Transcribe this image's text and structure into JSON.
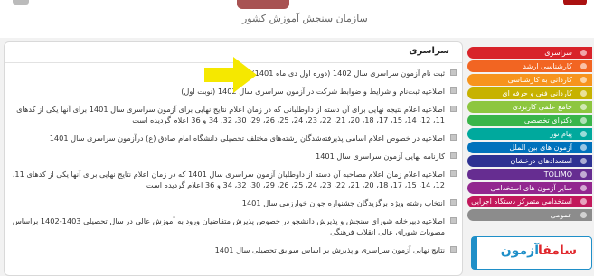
{
  "header": {
    "org_name": "سازمان سنجش آموزش کشور"
  },
  "news_panel": {
    "title": "سراسری",
    "items": [
      "ثبت نام آزمون سراسری سال 1402 (دوره اول دی ماه 1401)",
      "اطلاعیه ثبت‌نام و شرایط و ضوابط شرکت در آزمون سراسری سال 1402 (نوبت اول)",
      "اطلاعیه اعلام نتیجه نهایی برای آن دسته از داوطلبانی که در زمان اعلام نتایج نهایی برای آزمون سراسری سال 1401 برای آنها یکی از کدهای 11، 12، 14، 15، 17، 18، 20، 21، 22، 23، 24، 25، 26، 29، 30، 32، 34 و 36 اعلام گردیده است",
      "اطلاعیه در خصوص اعلام اسامی پذیرفته‌شدگان رشته‌های مختلف تحصیلی دانشگاه امام صادق (ع) درآزمون سراسری سال 1401",
      "کارنامه نهایی آزمون سراسری سال 1401",
      "اطلاعیه اعلام زمان اعلام مصاحبه آن دسته از داوطلبان آزمون سراسری سال 1401 که در زمان اعلام نتایج نهایی برای آنها یکی از کدهای 11، 12، 14، 15، 17، 18، 20، 21، 22، 23، 24، 25، 26، 29، 30، 32، 34 و 36 اعلام گردیده است",
      "انتخاب رشته ویژه برگزیدگان جشنواره جوان خوارزمی سال 1401",
      "اطلاعیه دبیرخانه شورای سنجش و پذیرش دانشجو در خصوص پذیرش متقاضیان ورود به آموزش عالی در سال تحصیلی 1403-1402 براساس مصوبات شورای عالی انقلاب فرهنگی",
      "نتایج نهایی آزمون سراسری و پذیرش بر اساس سوابق تحصیلی سال 1401"
    ]
  },
  "sidebar": {
    "items": [
      {
        "label": "سراسری",
        "color": "#d8232a"
      },
      {
        "label": "کارشناسی ارشد",
        "color": "#f26522"
      },
      {
        "label": "کاردانی به کارشناسی",
        "color": "#f7941d"
      },
      {
        "label": "کاردانی فنی و حرفه ای",
        "color": "#c7b200"
      },
      {
        "label": "جامع علمی کاربردی",
        "color": "#8dc63f"
      },
      {
        "label": "دکترای تخصصی",
        "color": "#39b54a"
      },
      {
        "label": "پیام نور",
        "color": "#00a99d"
      },
      {
        "label": "آزمون های بین الملل",
        "color": "#0072bc"
      },
      {
        "label": "استعدادهای درخشان",
        "color": "#2e3192"
      },
      {
        "label": "TOLIMO",
        "color": "#662d91"
      },
      {
        "label": "سایر آزمون های استخدامی",
        "color": "#92278f"
      },
      {
        "label": "استخدامی متمرکز دستگاه اجرایی",
        "color": "#c2185b"
      },
      {
        "label": "عمومی",
        "color": "#8c8c8c"
      }
    ]
  },
  "banner": {
    "part1": "آزمون",
    "part2": "سامفا"
  }
}
